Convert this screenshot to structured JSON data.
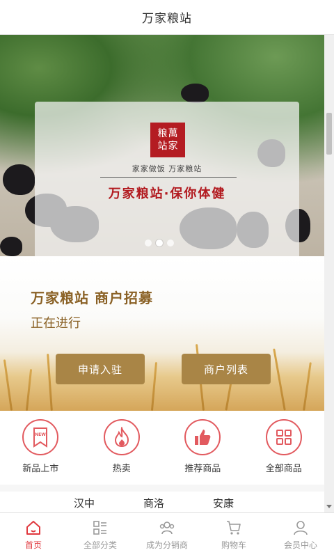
{
  "header": {
    "title": "万家粮站"
  },
  "banner": {
    "seal_chars": [
      "粮",
      "萬",
      "站",
      "家"
    ],
    "subtitle": "家家做饭  万家粮站",
    "slogan": "万家粮站·保你体健",
    "dots": 3,
    "active_dot": 1
  },
  "recruit": {
    "title": "万家粮站  商户招募",
    "status": "正在进行",
    "apply_label": "申请入驻",
    "list_label": "商户列表"
  },
  "quick": {
    "items": [
      {
        "label": "新品上市",
        "icon": "new-bookmark-icon"
      },
      {
        "label": "热卖",
        "icon": "flame-icon"
      },
      {
        "label": "推荐商品",
        "icon": "thumbs-up-icon"
      },
      {
        "label": "全部商品",
        "icon": "grid-icon"
      }
    ]
  },
  "regions": {
    "items": [
      "汉中",
      "商洛",
      "安康"
    ]
  },
  "nav": {
    "items": [
      {
        "label": "首页",
        "icon": "home-icon",
        "active": true
      },
      {
        "label": "全部分类",
        "icon": "category-list-icon",
        "active": false
      },
      {
        "label": "成为分销商",
        "icon": "distributor-icon",
        "active": false
      },
      {
        "label": "购物车",
        "icon": "cart-icon",
        "active": false
      },
      {
        "label": "会员中心",
        "icon": "user-icon",
        "active": false
      }
    ]
  },
  "colors": {
    "accent": "#e0383e",
    "gold": "#a98546",
    "brand_red": "#b21a1f"
  }
}
